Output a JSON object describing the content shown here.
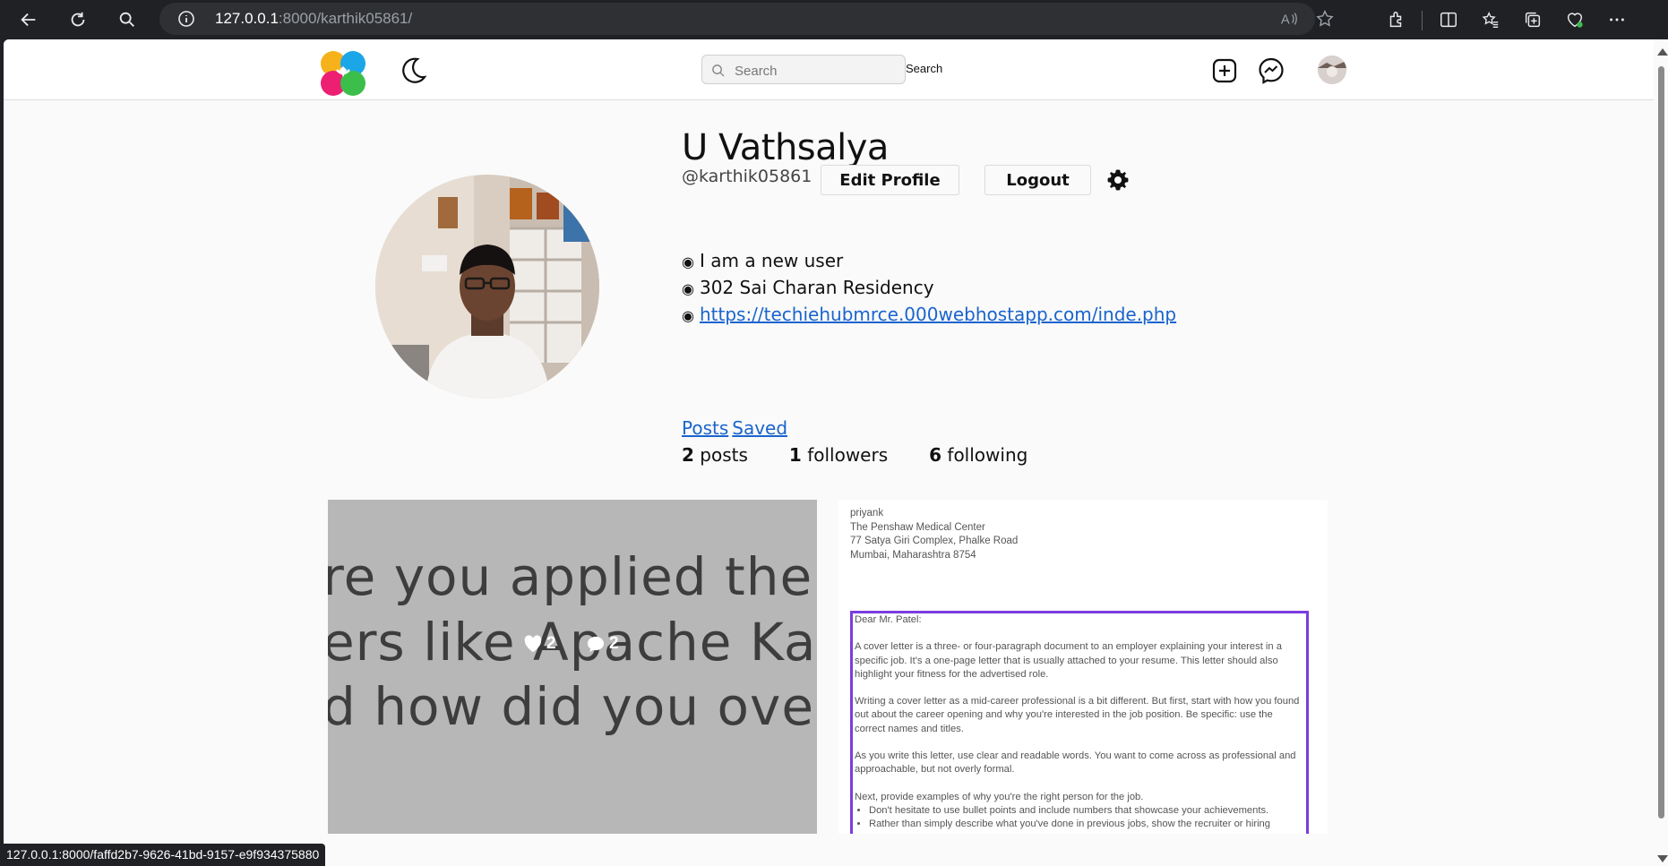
{
  "browser": {
    "url_host": "127.0.0.1",
    "url_rest": ":8000/karthik05861/",
    "status_url": "127.0.0.1:8000/faffd2b7-9626-41bd-9157-e9f934375880"
  },
  "nav": {
    "search_placeholder": "Search",
    "search_button": "Search"
  },
  "profile": {
    "name": "U Vathsalya",
    "handle": "@karthik05861",
    "edit_label": "Edit Profile",
    "logout_label": "Logout",
    "bio": [
      "I am a new user",
      "302 Sai Charan Residency"
    ],
    "website": "https://techiehubmrce.000webhostapp.com/inde.php",
    "tabs": {
      "posts": "Posts",
      "saved": "Saved"
    },
    "stats": {
      "posts_count": "2",
      "posts_label": "posts",
      "followers_count": "1",
      "followers_label": "followers",
      "following_count": "6",
      "following_label": "following"
    }
  },
  "posts": [
    {
      "lines": [
        "re you applied the p",
        "ers like Apache Kafk",
        "d how did you overc"
      ],
      "likes": "2",
      "comments": "2"
    },
    {
      "header": [
        "priyank",
        "The Penshaw Medical Center",
        "77 Satya Giri Complex, Phalke Road",
        "Mumbai, Maharashtra 8754"
      ],
      "salutation": "Dear Mr. Patel:",
      "paragraphs": [
        "A cover letter is a three- or four-paragraph document to an employer explaining your interest in a specific job. It's a one-page letter that is usually attached to your resume. This letter should also highlight your fitness for the advertised role.",
        "Writing a cover letter as a mid-career professional is a bit different. But first, start with how you found out about the career opening and why you're interested in the job position. Be specific: use the correct names and titles.",
        "As you write this letter, use clear and readable words. You want to come across as professional and approachable, but not overly formal.",
        "Next, provide examples of why you're the right person for the job."
      ],
      "bullets": [
        "Don't hesitate to use bullet points and include numbers that showcase your achievements.",
        "Rather than simply describe what you've done in previous jobs, show the recruiter or hiring manager what you can bring to the role."
      ]
    }
  ]
}
